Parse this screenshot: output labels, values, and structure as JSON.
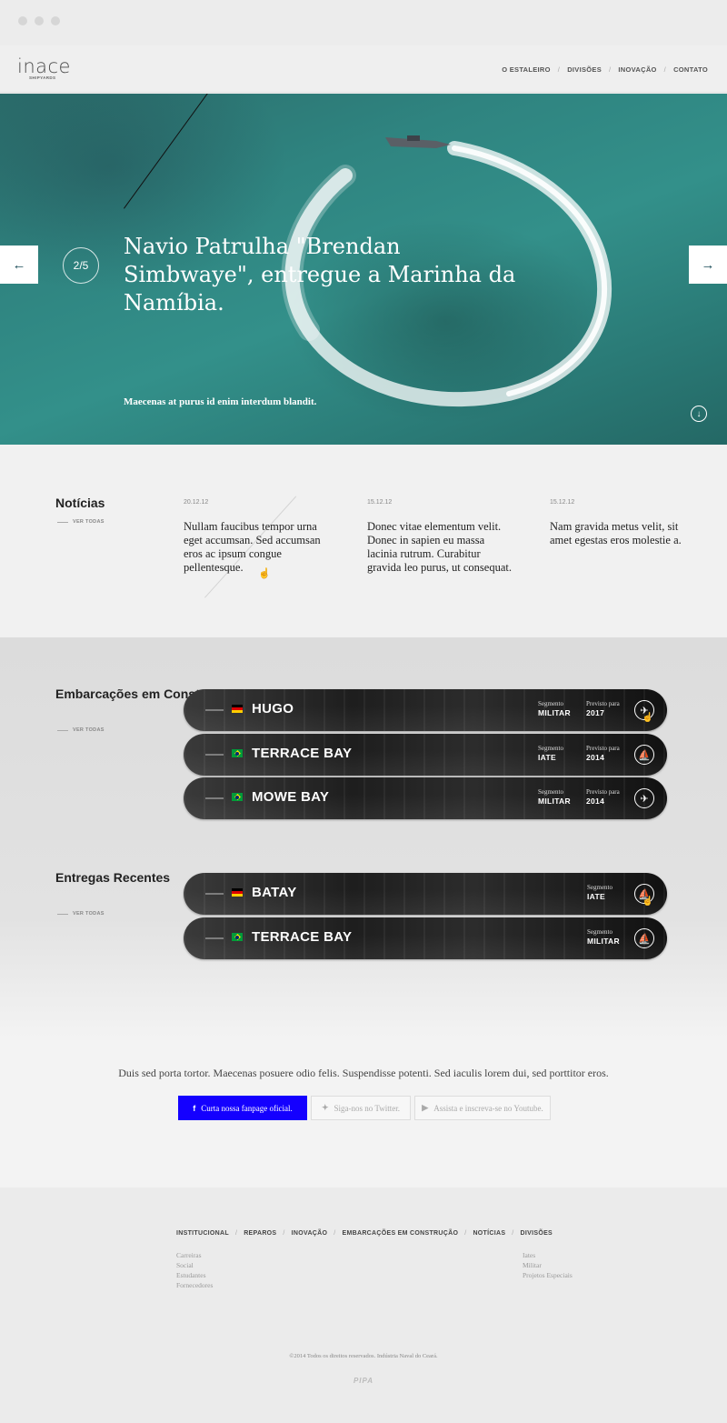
{
  "header": {
    "logo": "inace",
    "logo_sub": "SHIPYARDS",
    "nav": [
      "O ESTALEIRO",
      "DIVISÕES",
      "INOVAÇÃO",
      "CONTATO"
    ]
  },
  "hero": {
    "counter": "2/5",
    "title": "Navio Patrulha \"Brendan Simbwaye\", entregue a Marinha da Namíbia.",
    "subtitle": "Maecenas at purus id enim interdum blandit.",
    "prev_arrow": "←",
    "next_arrow": "→",
    "down_icon": "↓"
  },
  "news": {
    "title": "Notícias",
    "see_all": "VER TODAS",
    "items": [
      {
        "date": "20.12.12",
        "text": "Nullam faucibus tempor urna eget accumsan. Sed accumsan eros ac ipsum congue pellentesque."
      },
      {
        "date": "15.12.12",
        "text": "Donec vitae elementum velit. Donec in sapien eu massa lacinia rutrum. Curabitur gravida leo purus, ut consequat."
      },
      {
        "date": "15.12.12",
        "text": "Nam gravida metus velit, sit amet egestas eros molestie a."
      }
    ]
  },
  "construction": {
    "title": "Embarcações em Construção",
    "see_all": "VER TODAS",
    "vessels": [
      {
        "name": "HUGO",
        "flag": "de",
        "segment_label": "Segmento",
        "segment": "MILITAR",
        "forecast_label": "Previsto para",
        "forecast": "2017",
        "icon": "✈"
      },
      {
        "name": "TERRACE BAY",
        "flag": "br",
        "segment_label": "Segmento",
        "segment": "IATE",
        "forecast_label": "Previsto para",
        "forecast": "2014",
        "icon": "⛵"
      },
      {
        "name": "MOWE BAY",
        "flag": "br",
        "segment_label": "Segmento",
        "segment": "MILITAR",
        "forecast_label": "Previsto para",
        "forecast": "2014",
        "icon": "✈"
      }
    ]
  },
  "deliveries": {
    "title": "Entregas Recentes",
    "see_all": "VER TODAS",
    "vessels": [
      {
        "name": "BATAY",
        "flag": "de",
        "segment_label": "Segmento",
        "segment": "IATE",
        "icon": "⛵"
      },
      {
        "name": "TERRACE BAY",
        "flag": "br",
        "segment_label": "Segmento",
        "segment": "MILITAR",
        "icon": "⛵"
      }
    ]
  },
  "social": {
    "text": "Duis sed porta tortor. Maecenas posuere odio felis. Suspendisse potenti. Sed iaculis lorem dui, sed porttitor eros.",
    "facebook": "Curta nossa fanpage oficial.",
    "twitter": "Siga-nos no Twitter.",
    "youtube": "Assista e inscreva-se no Youtube."
  },
  "footer": {
    "nav": [
      "INSTITUCIONAL",
      "REPAROS",
      "INOVAÇÃO",
      "EMBARCAÇÕES EM CONSTRUÇÃO",
      "NOTÍCIAS",
      "DIVISÕES"
    ],
    "institucional_links": [
      "Carreiras",
      "Social",
      "Estudantes",
      "Fornecedores"
    ],
    "divisoes_links": [
      "Iates",
      "Militar",
      "Projetos Especiais"
    ],
    "copyright": "©2014 Todos os direitos reservados. Indústria Naval do Ceará.",
    "credit": "PIPA"
  }
}
